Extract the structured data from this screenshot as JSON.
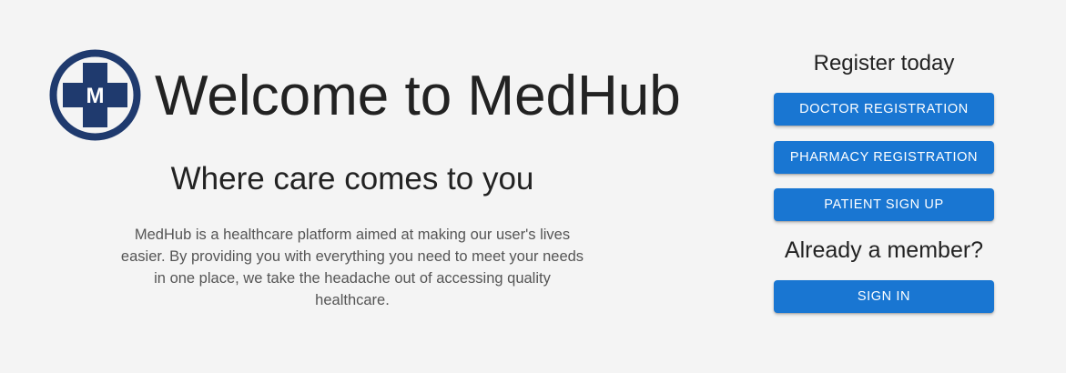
{
  "brand": {
    "logo_letter": "M",
    "logo_primary_color": "#1f3a6e",
    "logo_icon": "medical-cross-logo-icon"
  },
  "hero": {
    "title": "Welcome to MedHub",
    "tagline": "Where care comes to you",
    "description": "MedHub is a healthcare platform aimed at making our user's lives easier. By providing you with everything you need to meet your needs in one place, we take the headache out of accessing quality healthcare."
  },
  "register": {
    "heading": "Register today",
    "doctor_label": "DOCTOR REGISTRATION",
    "pharmacy_label": "PHARMACY REGISTRATION",
    "patient_label": "PATIENT SIGN UP"
  },
  "member": {
    "heading": "Already a member?",
    "signin_label": "SIGN IN"
  },
  "colors": {
    "background": "#f4f4f4",
    "button": "#1976d2",
    "button_text": "#ffffff",
    "text": "#222222",
    "muted_text": "#555555"
  }
}
